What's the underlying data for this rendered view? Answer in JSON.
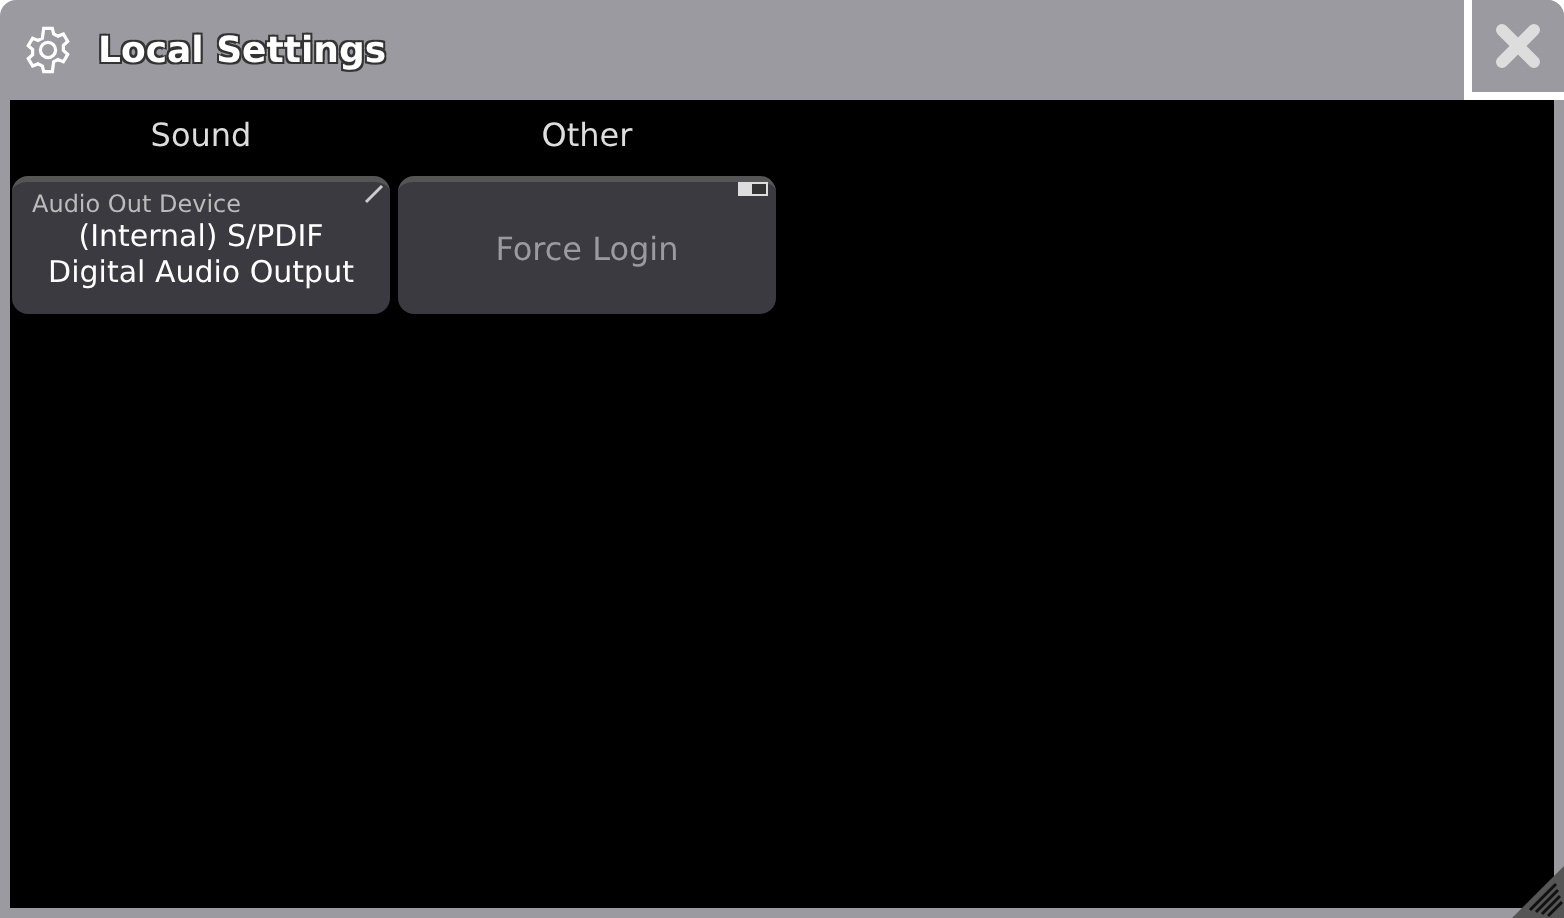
{
  "window": {
    "title": "Local Settings"
  },
  "sections": [
    {
      "title": "Sound",
      "button": {
        "kind": "value",
        "label": "Audio Out Device",
        "value": "(Internal) S/PDIF\nDigital Audio Output"
      }
    },
    {
      "title": "Other",
      "button": {
        "kind": "toggle",
        "value": "Force Login",
        "on": false
      }
    }
  ]
}
